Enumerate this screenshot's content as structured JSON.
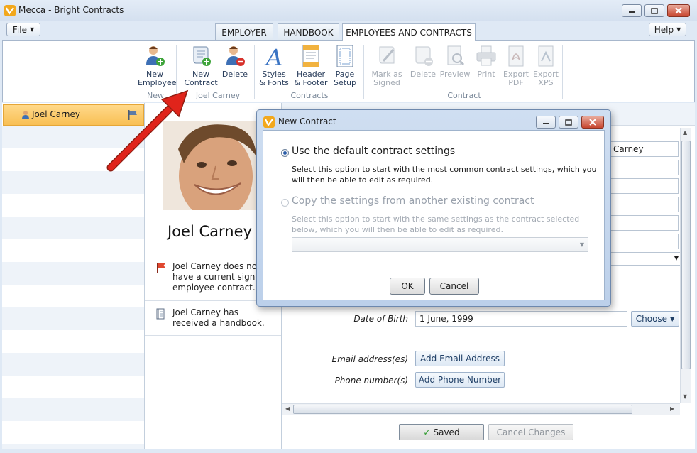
{
  "window": {
    "title": "Mecca - Bright Contracts"
  },
  "menu": {
    "file_label": "File",
    "help_label": "Help"
  },
  "tabs": [
    {
      "label": "EMPLOYER",
      "active": false
    },
    {
      "label": "HANDBOOK",
      "active": false
    },
    {
      "label": "EMPLOYEES AND CONTRACTS",
      "active": true
    }
  ],
  "ribbon": {
    "groups": [
      {
        "label": "New",
        "buttons": [
          {
            "label1": "New",
            "label2": "Employee",
            "icon": "new-employee-icon",
            "enabled": true
          }
        ]
      },
      {
        "label": "Joel Carney",
        "buttons": [
          {
            "label1": "New",
            "label2": "Contract",
            "icon": "new-contract-icon",
            "enabled": true
          },
          {
            "label1": "Delete",
            "label2": "",
            "icon": "delete-employee-icon",
            "enabled": true
          }
        ]
      },
      {
        "label": "Contracts",
        "buttons": [
          {
            "label1": "Styles",
            "label2": "& Fonts",
            "icon": "styles-fonts-icon",
            "enabled": true
          },
          {
            "label1": "Header",
            "label2": "& Footer",
            "icon": "header-footer-icon",
            "enabled": true
          },
          {
            "label1": "Page",
            "label2": "Setup",
            "icon": "page-setup-icon",
            "enabled": true
          }
        ]
      },
      {
        "label": "Contract",
        "buttons": [
          {
            "label1": "Mark as",
            "label2": "Signed",
            "icon": "mark-signed-icon",
            "enabled": false
          },
          {
            "label1": "Delete",
            "label2": "",
            "icon": "delete-contract-icon",
            "enabled": false
          },
          {
            "label1": "Preview",
            "label2": "",
            "icon": "preview-icon",
            "enabled": false
          },
          {
            "label1": "Print",
            "label2": "",
            "icon": "print-icon",
            "enabled": false
          },
          {
            "label1": "Export",
            "label2": "PDF",
            "icon": "export-pdf-icon",
            "enabled": false
          },
          {
            "label1": "Export",
            "label2": "XPS",
            "icon": "export-xps-icon",
            "enabled": false
          }
        ]
      }
    ]
  },
  "employees": [
    {
      "name": "Joel Carney",
      "selected": true
    }
  ],
  "profile": {
    "name": "Joel Carney",
    "notes": [
      {
        "icon": "red-flag-icon",
        "text": "Joel Carney does not have a current signed employee contract."
      },
      {
        "icon": "handbook-icon",
        "text": "Joel Carney has received a handbook."
      }
    ]
  },
  "details": {
    "last_name_value": "Carney",
    "dob_label": "Date of Birth",
    "dob_value": "1 June, 1999",
    "choose_label": "Choose",
    "email_label": "Email address(es)",
    "add_email_label": "Add Email Address",
    "phone_label": "Phone number(s)",
    "add_phone_label": "Add Phone Number",
    "saved_label": "Saved",
    "cancel_changes_label": "Cancel Changes"
  },
  "dialog": {
    "title": "New Contract",
    "option1": {
      "title": "Use the default contract settings",
      "desc": "Select this option to start with the most common contract settings, which you will then be able to edit as required.",
      "selected": true
    },
    "option2": {
      "title": "Copy the settings from another existing contract",
      "desc": "Select this option to start with the same settings as the contract selected below, which you will then be able to edit as required.",
      "selected": false
    },
    "contract_select_value": "",
    "ok_label": "OK",
    "cancel_label": "Cancel"
  },
  "colors": {
    "selection": "#f8bf54",
    "accent": "#2b5da8",
    "annotation_arrow": "#e0241b"
  }
}
